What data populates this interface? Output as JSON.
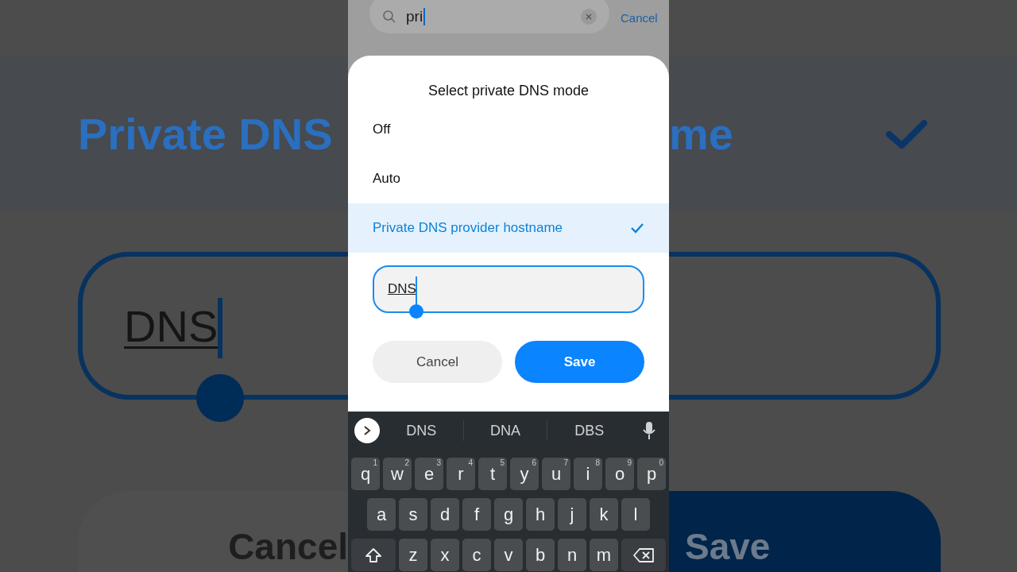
{
  "backdrop": {
    "left": {
      "title": "Private DNS",
      "field_value": "DNS",
      "button": "Cancel"
    },
    "right": {
      "title": "me",
      "button": "Save"
    }
  },
  "search": {
    "value": "pri",
    "cancel": "Cancel"
  },
  "dialog": {
    "title": "Select private DNS mode",
    "options": [
      {
        "label": "Off",
        "selected": false
      },
      {
        "label": "Auto",
        "selected": false
      },
      {
        "label": "Private DNS provider hostname",
        "selected": true
      }
    ],
    "field_value": "DNS",
    "buttons": [
      {
        "label": "Cancel",
        "kind": "secondary"
      },
      {
        "label": "Save",
        "kind": "primary"
      }
    ]
  },
  "keyboard": {
    "suggestions": [
      "DNS",
      "DNA",
      "DBS"
    ],
    "rows": [
      [
        {
          "kind": "letter",
          "label": "q",
          "hint": "1"
        },
        {
          "kind": "letter",
          "label": "w",
          "hint": "2"
        },
        {
          "kind": "letter",
          "label": "e",
          "hint": "3"
        },
        {
          "kind": "letter",
          "label": "r",
          "hint": "4"
        },
        {
          "kind": "letter",
          "label": "t",
          "hint": "5"
        },
        {
          "kind": "letter",
          "label": "y",
          "hint": "6"
        },
        {
          "kind": "letter",
          "label": "u",
          "hint": "7"
        },
        {
          "kind": "letter",
          "label": "i",
          "hint": "8"
        },
        {
          "kind": "letter",
          "label": "o",
          "hint": "9"
        },
        {
          "kind": "letter",
          "label": "p",
          "hint": "0"
        }
      ],
      [
        {
          "kind": "letter",
          "label": "a"
        },
        {
          "kind": "letter",
          "label": "s"
        },
        {
          "kind": "letter",
          "label": "d"
        },
        {
          "kind": "letter",
          "label": "f"
        },
        {
          "kind": "letter",
          "label": "g"
        },
        {
          "kind": "letter",
          "label": "h"
        },
        {
          "kind": "letter",
          "label": "j"
        },
        {
          "kind": "letter",
          "label": "k"
        },
        {
          "kind": "letter",
          "label": "l"
        }
      ],
      [
        {
          "kind": "shift"
        },
        {
          "kind": "letter",
          "label": "z"
        },
        {
          "kind": "letter",
          "label": "x"
        },
        {
          "kind": "letter",
          "label": "c"
        },
        {
          "kind": "letter",
          "label": "v"
        },
        {
          "kind": "letter",
          "label": "b"
        },
        {
          "kind": "letter",
          "label": "n"
        },
        {
          "kind": "letter",
          "label": "m"
        },
        {
          "kind": "backspace"
        }
      ]
    ]
  }
}
